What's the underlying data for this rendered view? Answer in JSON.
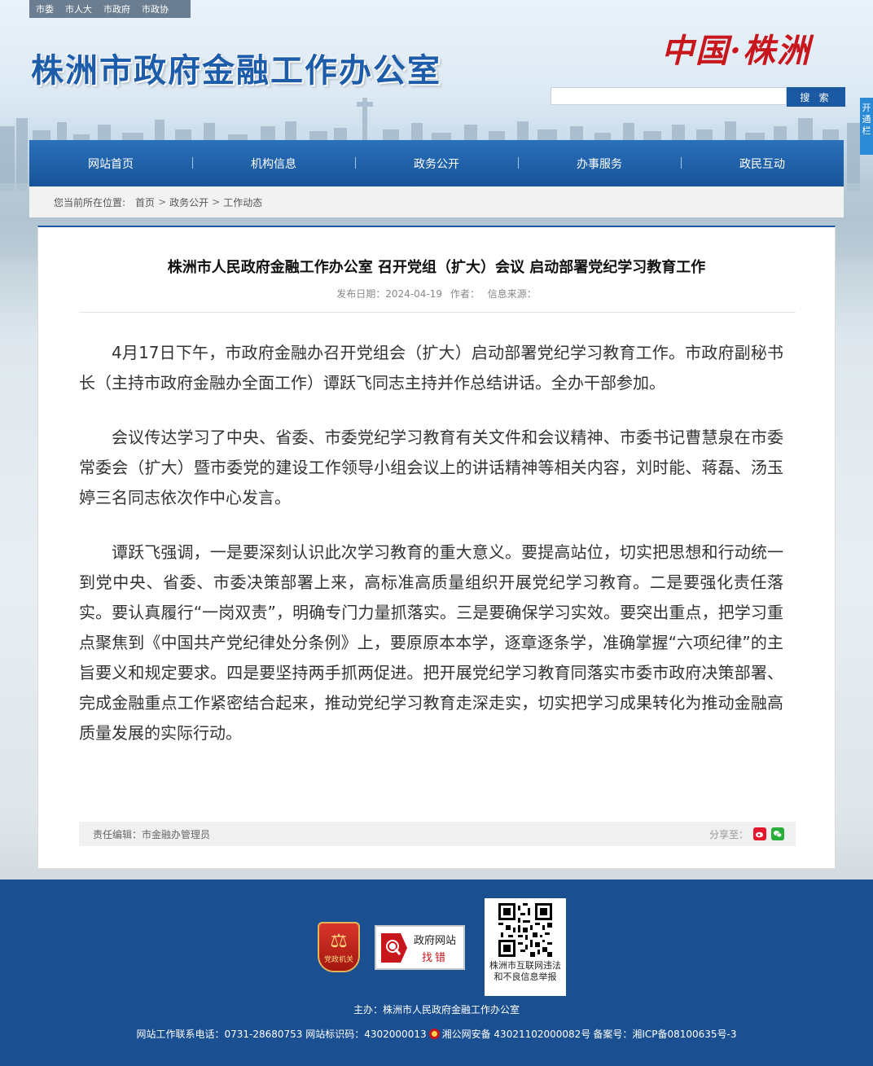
{
  "topbar": {
    "links": [
      "市委",
      "市人大",
      "市政府",
      "市政协"
    ]
  },
  "header": {
    "site_title": "株洲市政府金融工作办公室",
    "logo_text": "中国·株洲",
    "search": {
      "placeholder": "",
      "button_label": "搜 索"
    },
    "side_tab": "开通栏"
  },
  "nav": {
    "items": [
      "网站首页",
      "机构信息",
      "政务公开",
      "办事服务",
      "政民互动"
    ]
  },
  "breadcrumb": {
    "prefix": "您当前所在位置:",
    "items": [
      "首页",
      "政务公开",
      "工作动态"
    ],
    "separator": ">"
  },
  "article": {
    "title": "株洲市人民政府金融工作办公室 召开党组（扩大）会议 启动部署党纪学习教育工作",
    "date_label": "发布日期：2024-04-19",
    "author_label": "作者：",
    "source_label": "信息来源：",
    "paragraphs": [
      "4月17日下午，市政府金融办召开党组会（扩大）启动部署党纪学习教育工作。市政府副秘书长（主持市政府金融办全面工作）谭跃飞同志主持并作总结讲话。全办干部参加。",
      "会议传达学习了中央、省委、市委党纪学习教育有关文件和会议精神、市委书记曹慧泉在市委常委会（扩大）暨市委党的建设工作领导小组会议上的讲话精神等相关内容，刘时能、蒋磊、汤玉婷三名同志依次作中心发言。",
      "谭跃飞强调，一是要深刻认识此次学习教育的重大意义。要提高站位，切实把思想和行动统一到党中央、省委、市委决策部署上来，高标准高质量组织开展党纪学习教育。二是要强化责任落实。要认真履行“一岗双责”，明确专门力量抓落实。三是要确保学习实效。要突出重点，把学习重点聚焦到《中国共产党纪律处分条例》上，要原原本本学，逐章逐条学，准确掌握“六项纪律”的主旨要义和规定要求。四是要坚持两手抓两促进。把开展党纪学习教育同落实市委市政府决策部署、完成金融重点工作紧密结合起来，推动党纪学习教育走深走实，切实把学习成果转化为推动金融高质量发展的实际行动。"
    ],
    "editor_label": "责任编辑：市金融办管理员",
    "share_label": "分享至："
  },
  "footer": {
    "party_badge_symbol": "⚖",
    "party_badge_text": "党政机关",
    "error_badge_line1": "政府网站",
    "error_badge_line2": "找错",
    "qr_caption": "株洲市互联网违法和不良信息举报",
    "sponsor": "主办：株洲市人民政府金融工作办公室",
    "contact": "网站工作联系电话：0731-28680753  网站标识码：4302000013",
    "police": "湘公网安备 43021102000082号",
    "icp": "备案号：湘ICP备08100635号-3"
  },
  "colors": {
    "brand_blue": "#1b5aa3",
    "nav_blue": "#2a70bc",
    "footer_blue": "#1a4f92",
    "logo_red": "#c8161d"
  }
}
